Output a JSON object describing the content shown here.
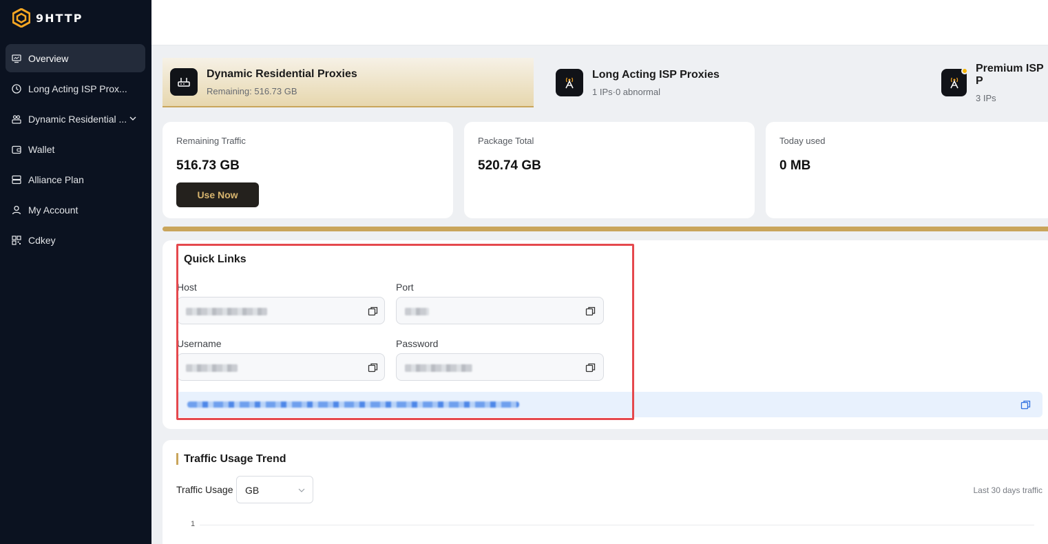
{
  "app": {
    "logo_text": "9HTTP",
    "brand_color": "#f5a623",
    "accent_gold": "#c9a55b"
  },
  "sidebar": {
    "items": [
      {
        "label": "Overview",
        "icon": "monitor-icon",
        "active": true
      },
      {
        "label": "Long Acting ISP Prox...",
        "icon": "clock-icon"
      },
      {
        "label": "Dynamic Residential ...",
        "icon": "users-icon",
        "expandable": true
      },
      {
        "label": "Wallet",
        "icon": "wallet-icon"
      },
      {
        "label": "Alliance Plan",
        "icon": "server-icon"
      },
      {
        "label": "My Account",
        "icon": "user-icon"
      },
      {
        "label": "Cdkey",
        "icon": "grid-icon"
      }
    ]
  },
  "tabs": [
    {
      "title": "Dynamic Residential Proxies",
      "subtitle": "Remaining: 516.73 GB",
      "icon": "router-icon",
      "active": true
    },
    {
      "title": "Long Acting ISP Proxies",
      "subtitle": "1 IPs·0 abnormal",
      "icon": "antenna-icon"
    },
    {
      "title": "Premium ISP P",
      "subtitle": "3 IPs",
      "icon": "antenna-icon",
      "badge": true
    }
  ],
  "stats": {
    "remaining": {
      "label": "Remaining Traffic",
      "value": "516.73 GB",
      "button": "Use Now"
    },
    "package": {
      "label": "Package Total",
      "value": "520.74 GB"
    },
    "today": {
      "label": "Today used",
      "value": "0 MB"
    }
  },
  "quick_links": {
    "title": "Quick Links",
    "host_label": "Host",
    "port_label": "Port",
    "username_label": "Username",
    "password_label": "Password"
  },
  "trend": {
    "title": "Traffic Usage Trend",
    "usage_label": "Traffic Usage",
    "unit_selected": "GB",
    "range_note": "Last 30 days traffic",
    "y_tick": "1"
  }
}
